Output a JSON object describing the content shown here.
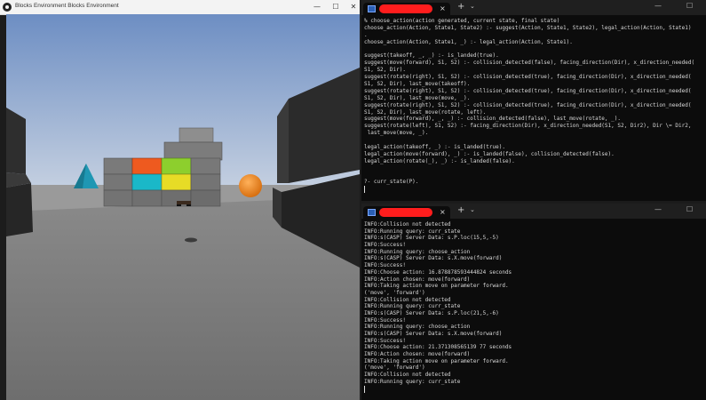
{
  "env_window": {
    "title": "Blocks Environment Blocks Environment",
    "minimize": "—",
    "maximize": "☐",
    "close": "✕"
  },
  "terminal_top": {
    "tab_close": "×",
    "tab_new": "+",
    "tab_dropdown": "⌄",
    "minimize": "—",
    "maximize": "☐",
    "lines": [
      "% choose_action(action generated, current state, final state)",
      "choose_action(Action, State1, State2) :- suggest(Action, State1, State2), legal_action(Action, State1)",
      ".",
      "choose_action(Action, State1, _) :- legal_action(Action, State1).",
      "",
      "suggest(takeoff, _, _) :- is_landed(true).",
      "suggest(move(forward), S1, S2) :- collision_detected(false), facing_direction(Dir), x_direction_needed(",
      "S1, S2, Dir).",
      "suggest(rotate(right), S1, S2) :- collision_detected(true), facing_direction(Dir), x_direction_needed(",
      "S1, S2, Dir), last_move(takeoff).",
      "suggest(rotate(right), S1, S2) :- collision_detected(true), facing_direction(Dir), x_direction_needed(",
      "S1, S2, Dir), last_move(move, _).",
      "suggest(rotate(right), S1, S2) :- collision_detected(true), facing_direction(Dir), x_direction_needed(",
      "S1, S2, Dir), last_move(rotate, left).",
      "suggest(move(forward), _, _) :- collision_detected(false), last_move(rotate, _).",
      "suggest(rotate(left), S1, S2) :- facing_direction(Dir), x_direction_needed(S1, S2, Dir2), Dir \\= Dir2,",
      " last_move(move, _).",
      "",
      "legal_action(takeoff, _) :- is_landed(true).",
      "legal_action(move(forward), _) :- is_landed(false), collision_detected(false).",
      "legal_action(rotate(_), _) :- is_landed(false).",
      "",
      "",
      "?- curr_state(P)."
    ]
  },
  "terminal_bottom": {
    "tab_close": "×",
    "tab_new": "+",
    "tab_dropdown": "⌄",
    "minimize": "—",
    "maximize": "☐",
    "lines": [
      "INFO:Collision not detected",
      "INFO:Running query: curr_state",
      "INFO:s(CASP) Server Data: s.P.loc(15,5,-5)",
      "INFO:Success!",
      "INFO:Running query: choose_action",
      "INFO:s(CASP) Server Data: s.X.move(forward)",
      "INFO:Success!",
      "INFO:Choose action: 16.878878593444824 seconds",
      "INFO:Action chosen: move(forward)",
      "INFO:Taking action move on parameter forward.",
      "('move', 'forward')",
      "INFO:Collision not detected",
      "INFO:Running query: curr_state",
      "INFO:s(CASP) Server Data: s.P.loc(21,5,-6)",
      "INFO:Success!",
      "INFO:Running query: choose_action",
      "INFO:s(CASP) Server Data: s.X.move(forward)",
      "INFO:Success!",
      "INFO:Choose action: 21.371308565139 77 seconds",
      "INFO:Action chosen: move(forward)",
      "INFO:Taking action move on parameter forward.",
      "('move', 'forward')",
      "INFO:Collision not detected",
      "INFO:Running query: curr_state"
    ]
  },
  "scene": {
    "sky_top": "#6f8fc4",
    "sky_bottom": "#c9d3e2",
    "ground": "#777777",
    "cone_color": "#1f97b3",
    "sphere_color": "#f08a1e",
    "block_colors": [
      "#ee5a1f",
      "#8dcf2d",
      "#1ab8c8",
      "#e7dc26"
    ]
  }
}
